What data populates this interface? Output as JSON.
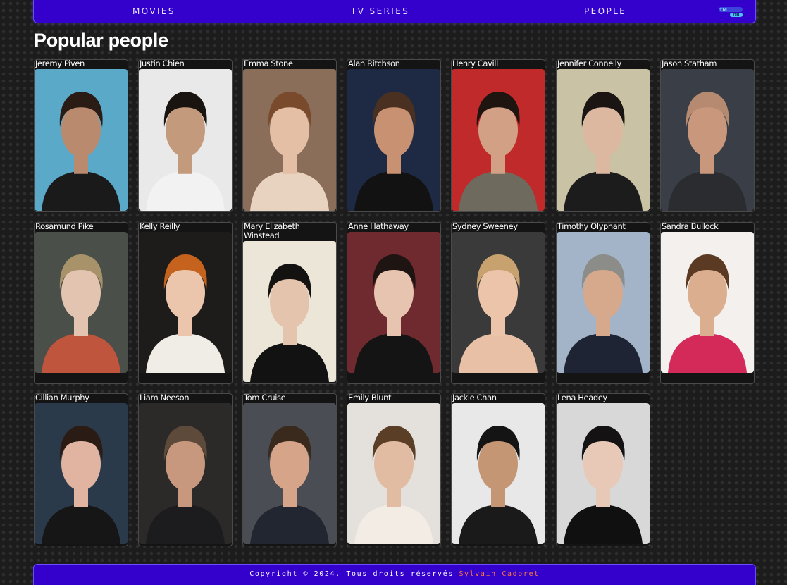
{
  "nav": {
    "movies": "MOVIES",
    "tv_series": "TV SERIES",
    "people": "PEOPLE",
    "logo": "TMDB",
    "logo_top": "TM",
    "logo_bottom": "DB"
  },
  "page_title": "Popular people",
  "people": [
    {
      "name": "Jeremy Piven",
      "bg": "#5aa9c9",
      "skin": "#b98a6e",
      "hair": "#2a1c14",
      "shirt": "#1a1a1a"
    },
    {
      "name": "Justin Chien",
      "bg": "#e9e9e9",
      "skin": "#c49a7c",
      "hair": "#1a1410",
      "shirt": "#f2f2f2"
    },
    {
      "name": "Emma Stone",
      "bg": "#8a6e5a",
      "skin": "#e4bfa6",
      "hair": "#7a4a2c",
      "shirt": "#e8d2c0"
    },
    {
      "name": "Alan Ritchson",
      "bg": "#1e2a44",
      "skin": "#c89272",
      "hair": "#4a3020",
      "shirt": "#121212"
    },
    {
      "name": "Henry Cavill",
      "bg": "#c02a2a",
      "skin": "#d2a084",
      "hair": "#1e1410",
      "shirt": "#6f6a5e"
    },
    {
      "name": "Jennifer Connelly",
      "bg": "#c9c2a4",
      "skin": "#ddb8a0",
      "hair": "#1a1412",
      "shirt": "#1c1c1c"
    },
    {
      "name": "Jason Statham",
      "bg": "#3a3e46",
      "skin": "#c9987c",
      "hair": "#b58a70",
      "shirt": "#2a2c30"
    },
    {
      "name": "Rosamund Pike",
      "bg": "#4a4f4a",
      "skin": "#e2c4b0",
      "hair": "#a8926a",
      "shirt": "#c0553e"
    },
    {
      "name": "Kelly Reilly",
      "bg": "#1e1c1a",
      "skin": "#ecc6ac",
      "hair": "#c4621e",
      "shirt": "#f0ece6"
    },
    {
      "name": "Mary Elizabeth Winstead",
      "bg": "#ece6d8",
      "skin": "#e4c4ac",
      "hair": "#141210",
      "shirt": "#121212"
    },
    {
      "name": "Anne Hathaway",
      "bg": "#6e2a2e",
      "skin": "#e6c4b0",
      "hair": "#1e1412",
      "shirt": "#141414"
    },
    {
      "name": "Sydney Sweeney",
      "bg": "#3a3a3a",
      "skin": "#ecc4aa",
      "hair": "#c8a26e",
      "shirt": "#e8c0a6"
    },
    {
      "name": "Timothy Olyphant",
      "bg": "#a4b4c8",
      "skin": "#d6a88c",
      "hair": "#8c8c88",
      "shirt": "#1e2434"
    },
    {
      "name": "Sandra Bullock",
      "bg": "#f4f0ee",
      "skin": "#dcae90",
      "hair": "#5a3a22",
      "shirt": "#d42a5a"
    },
    {
      "name": "Cillian Murphy",
      "bg": "#2a3a4a",
      "skin": "#e0b4a0",
      "hair": "#2a1c14",
      "shirt": "#161616"
    },
    {
      "name": "Liam Neeson",
      "bg": "#2c2a28",
      "skin": "#c8987e",
      "hair": "#5e4a3a",
      "shirt": "#1c1c1e"
    },
    {
      "name": "Tom Cruise",
      "bg": "#4a4e54",
      "skin": "#d6a488",
      "hair": "#3a2a1e",
      "shirt": "#222630"
    },
    {
      "name": "Emily Blunt",
      "bg": "#e4e0dc",
      "skin": "#e2bca2",
      "hair": "#5a3e26",
      "shirt": "#f2ece4"
    },
    {
      "name": "Jackie Chan",
      "bg": "#e8e8e8",
      "skin": "#c49674",
      "hair": "#141414",
      "shirt": "#1a1a1a"
    },
    {
      "name": "Lena Headey",
      "bg": "#d8d8d8",
      "skin": "#e8c8b6",
      "hair": "#141212",
      "shirt": "#101010"
    }
  ],
  "footer": {
    "text": "Copyright © 2024. Tous droits réservés ",
    "author": "Sylvain Cadoret"
  },
  "colors": {
    "nav_bg": "#3300cc",
    "nav_border": "#6b4cff",
    "page_bg": "#1c1c1c",
    "footer_accent": "#ff7a3a",
    "logo_accent": "#4fc3f7"
  }
}
